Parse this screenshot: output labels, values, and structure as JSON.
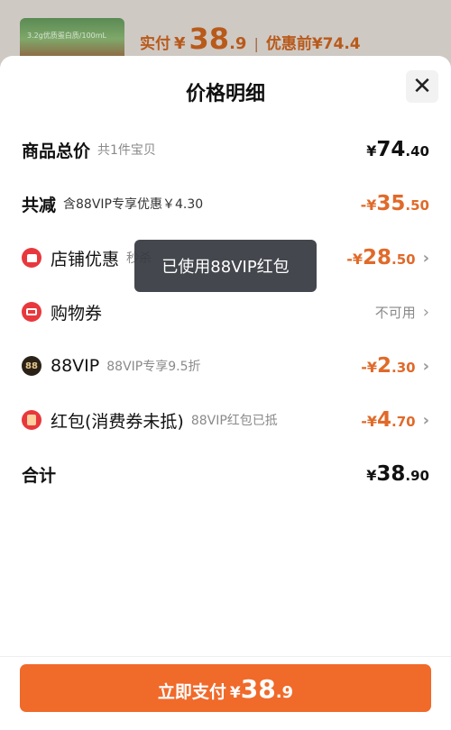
{
  "background": {
    "thumb_caption": "3.2g优质蛋白质/100mL",
    "paid_label": "实付",
    "paid_symbol": "¥",
    "paid_int": "38",
    "paid_dec": ".9",
    "before_label": "优惠前¥74.4"
  },
  "sheet": {
    "title": "价格明细",
    "rows": {
      "total": {
        "label": "商品总价",
        "sub": "共1件宝贝",
        "amount": {
          "sym": "¥",
          "int": "74",
          "dec": ".40"
        }
      },
      "reduce": {
        "label": "共减",
        "sub": "含88VIP专享优惠￥4.30",
        "amount": {
          "sym": "-¥",
          "int": "35",
          "dec": ".50"
        }
      },
      "shop": {
        "label": "店铺优惠",
        "sub": "秒杀",
        "amount": {
          "sym": "-¥",
          "int": "28",
          "dec": ".50"
        }
      },
      "coupon": {
        "label": "购物券",
        "status": "不可用"
      },
      "vip": {
        "label": "88VIP",
        "sub": "88VIP专享9.5折",
        "amount": {
          "sym": "-¥",
          "int": "2",
          "dec": ".30"
        },
        "icon_text": "88"
      },
      "redpacket": {
        "label": "红包(消费券未抵)",
        "sub": "88VIP红包已抵",
        "amount": {
          "sym": "-¥",
          "int": "4",
          "dec": ".70"
        }
      },
      "sum": {
        "label": "合计",
        "amount": {
          "sym": "¥",
          "int": "38",
          "dec": ".90"
        }
      }
    }
  },
  "toast": {
    "text": "已使用88VIP红包"
  },
  "pay_button": {
    "label": "立即支付",
    "sym": "¥",
    "int": "38",
    "dec": ".9"
  },
  "colors": {
    "accent": "#f06a2a",
    "discount": "#e06a2a",
    "icon_red": "#e8383d"
  }
}
